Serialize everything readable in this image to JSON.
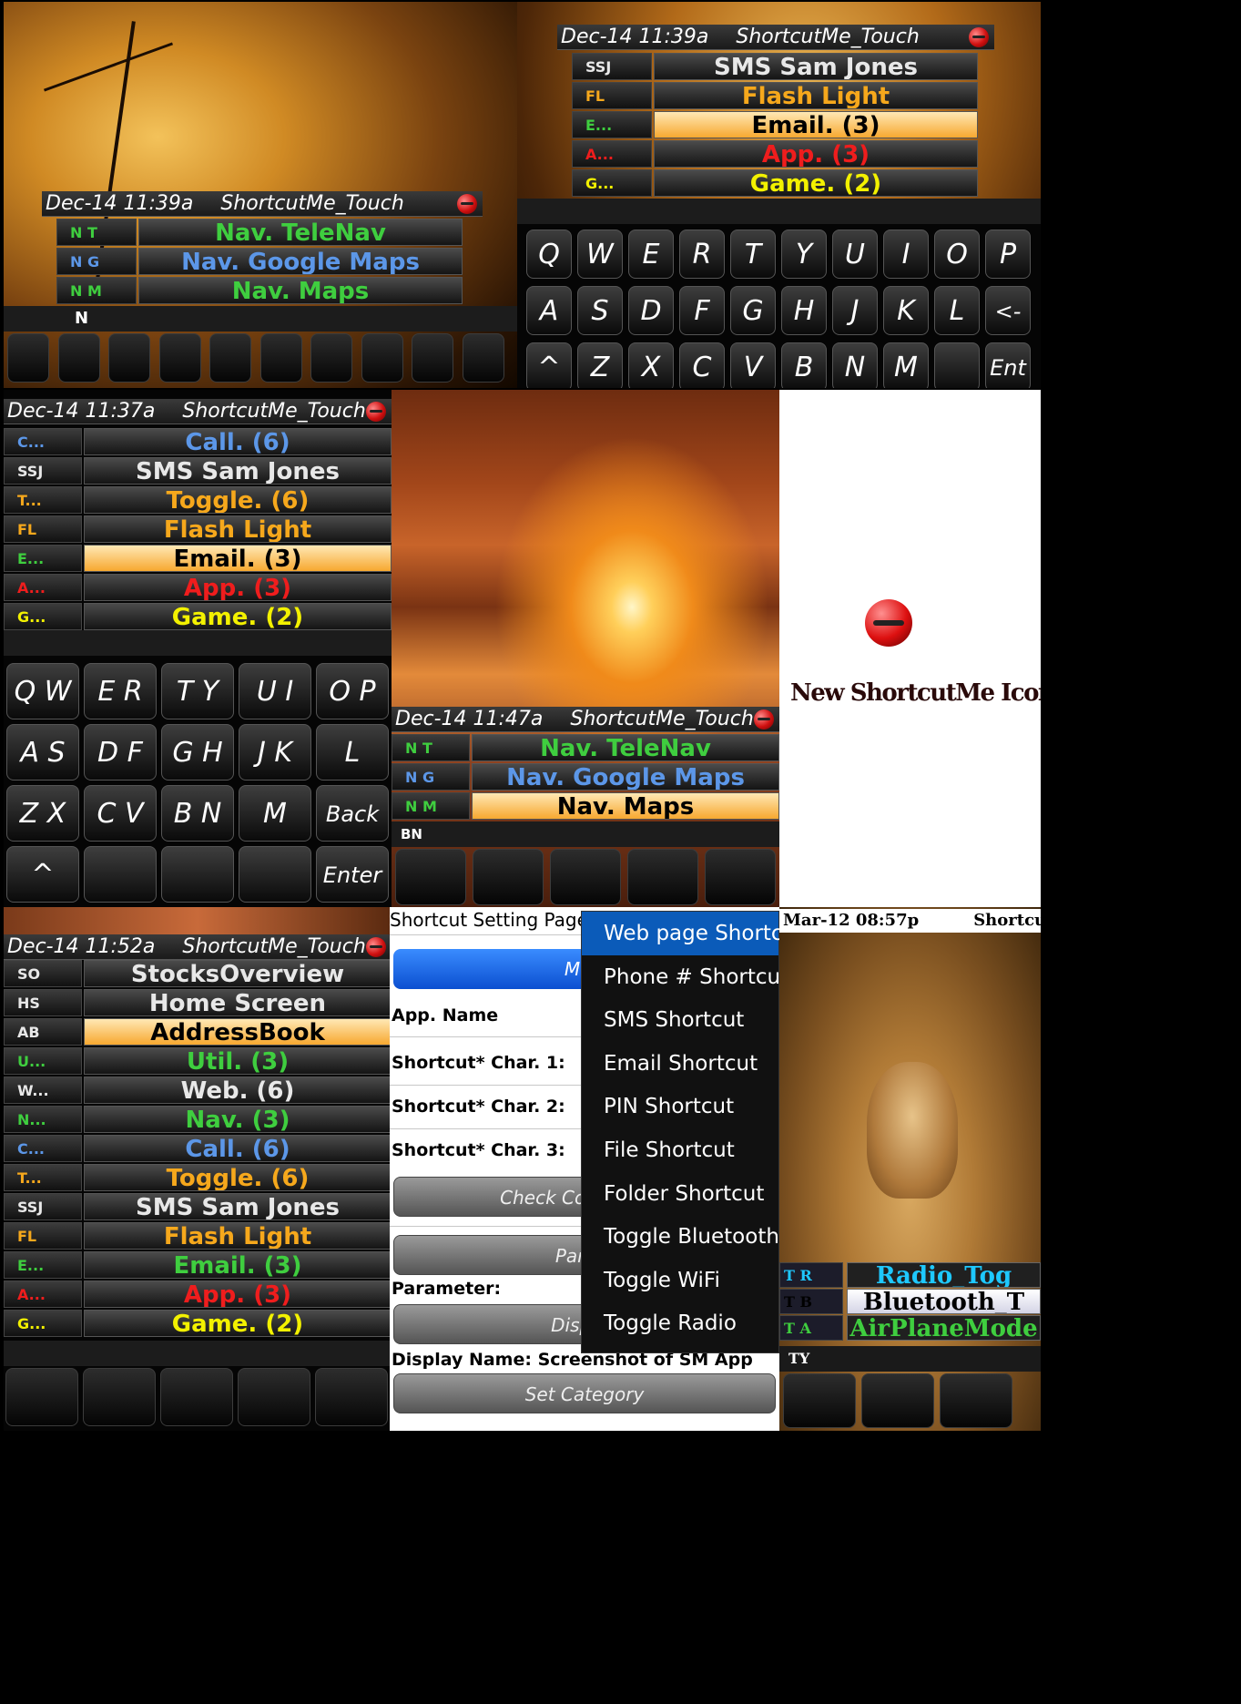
{
  "panel1": {
    "title_time": "Dec-14 11:39a",
    "title_app": "ShortcutMe_Touch",
    "rows": [
      {
        "code": "N T",
        "label": "Nav. TeleNav",
        "color": "green"
      },
      {
        "code": "N G",
        "label": "Nav. Google Maps",
        "color": "blue"
      },
      {
        "code": "N M",
        "label": "Nav. Maps",
        "color": "green"
      }
    ],
    "input": "N"
  },
  "panel2": {
    "title_time": "Dec-14 11:39a",
    "title_app": "ShortcutMe_Touch",
    "rows": [
      {
        "code": "SSJ",
        "label": "SMS Sam Jones",
        "color": "white"
      },
      {
        "code": "FL",
        "label": "Flash Light",
        "color": "orange"
      },
      {
        "code": "E...",
        "label": "Email. (3)",
        "color": "green",
        "selected": true
      },
      {
        "code": "A...",
        "label": "App. (3)",
        "color": "red"
      },
      {
        "code": "G...",
        "label": "Game. (2)",
        "color": "yellow"
      }
    ],
    "keys_row1": [
      "Q",
      "W",
      "E",
      "R",
      "T",
      "Y",
      "U",
      "I",
      "O",
      "P"
    ],
    "keys_row2": [
      "A",
      "S",
      "D",
      "F",
      "G",
      "H",
      "J",
      "K",
      "L",
      "<-"
    ],
    "keys_row3": [
      "^",
      "Z",
      "X",
      "C",
      "V",
      "B",
      "N",
      "M",
      "",
      "Ent"
    ]
  },
  "panel3": {
    "title_time": "Dec-14 11:37a",
    "title_app": "ShortcutMe_Touch",
    "rows": [
      {
        "code": "C...",
        "label": "Call. (6)",
        "color": "blue"
      },
      {
        "code": "SSJ",
        "label": "SMS Sam Jones",
        "color": "white"
      },
      {
        "code": "T...",
        "label": "Toggle. (6)",
        "color": "orange"
      },
      {
        "code": "FL",
        "label": "Flash Light",
        "color": "orange"
      },
      {
        "code": "E...",
        "label": "Email. (3)",
        "color": "green",
        "selected": true
      },
      {
        "code": "A...",
        "label": "App. (3)",
        "color": "red"
      },
      {
        "code": "G...",
        "label": "Game. (2)",
        "color": "yellow"
      }
    ],
    "keys": [
      [
        "Q W",
        "E R",
        "T Y",
        "U I",
        "O P"
      ],
      [
        "A S",
        "D F",
        "G H",
        "J K",
        "L"
      ],
      [
        "Z X",
        "C V",
        "B N",
        "M",
        "Back"
      ],
      [
        "^",
        "",
        "",
        "",
        "Enter"
      ]
    ]
  },
  "panel4": {
    "title_time": "Dec-14 11:47a",
    "title_app": "ShortcutMe_Touch",
    "rows": [
      {
        "code": "N T",
        "label": "Nav. TeleNav",
        "color": "green"
      },
      {
        "code": "N G",
        "label": "Nav. Google Maps",
        "color": "blue"
      },
      {
        "code": "N M",
        "label": "Nav. Maps",
        "color": "green",
        "selected": true
      }
    ],
    "input": "BN"
  },
  "panel5": {
    "caption": "New ShortcutMe Icon"
  },
  "panel6": {
    "title_time": "Dec-14 11:52a",
    "title_app": "ShortcutMe_Touch",
    "rows": [
      {
        "code": "SO",
        "label": "StocksOverview",
        "color": "white"
      },
      {
        "code": "HS",
        "label": "Home Screen",
        "color": "white"
      },
      {
        "code": "AB",
        "label": "AddressBook",
        "color": "white",
        "selected": true
      },
      {
        "code": "U...",
        "label": "Util. (3)",
        "color": "green"
      },
      {
        "code": "W...",
        "label": "Web. (6)",
        "color": "white"
      },
      {
        "code": "N...",
        "label": "Nav. (3)",
        "color": "green"
      },
      {
        "code": "C...",
        "label": "Call. (6)",
        "color": "blue"
      },
      {
        "code": "T...",
        "label": "Toggle. (6)",
        "color": "orange"
      },
      {
        "code": "SSJ",
        "label": "SMS Sam Jones",
        "color": "white"
      },
      {
        "code": "FL",
        "label": "Flash Light",
        "color": "orange"
      },
      {
        "code": "E...",
        "label": "Email. (3)",
        "color": "green"
      },
      {
        "code": "A...",
        "label": "App. (3)",
        "color": "red"
      },
      {
        "code": "G...",
        "label": "Game. (2)",
        "color": "yellow"
      }
    ]
  },
  "panel7": {
    "header": "Shortcut Setting Page",
    "most_used": "Most Used",
    "app_name": "App. Name",
    "char1": "Shortcut*  Char. 1:",
    "char2": "Shortcut*  Char. 2:",
    "char3": "Shortcut*  Char. 3:",
    "check_conflict": "Check Conflict (for",
    "param_btn": "Param",
    "parameter": "Parameter:",
    "display_btn": "Display",
    "display_name": "Display Name: Screenshot of SM App",
    "set_category": "Set Category",
    "menu": [
      "Web page Shortcut",
      "Phone # Shortcut",
      "SMS Shortcut",
      "Email Shortcut",
      "PIN Shortcut",
      "File Shortcut",
      "Folder Shortcut",
      "Toggle Bluetooth",
      "Toggle WiFi",
      "Toggle Radio"
    ]
  },
  "panel8": {
    "title_time": "Mar-12 08:57p",
    "title_app": "ShortcutMe",
    "rows": [
      {
        "code": "T R",
        "label": "Radio_Tog",
        "color": "cyan"
      },
      {
        "code": "T B",
        "label": "Bluetooth_T",
        "color": "black",
        "selected": true
      },
      {
        "code": "T A",
        "label": "AirPlaneMode",
        "color": "green"
      }
    ],
    "input": "TY"
  }
}
